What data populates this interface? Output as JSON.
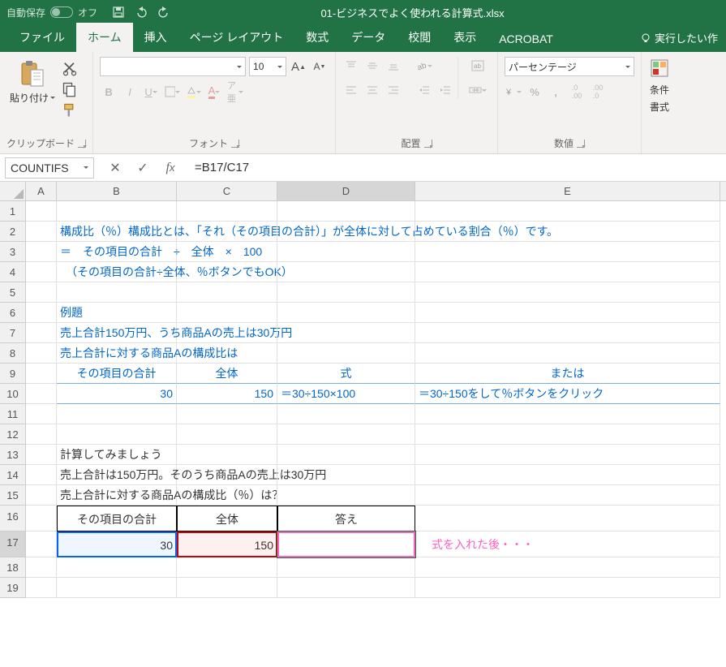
{
  "titlebar": {
    "autosave_label": "自動保存",
    "autosave_state": "オフ",
    "filename": "01-ビジネスでよく使われる計算式.xlsx"
  },
  "tabs": {
    "file": "ファイル",
    "home": "ホーム",
    "insert": "挿入",
    "page_layout": "ページ レイアウト",
    "formulas": "数式",
    "data": "データ",
    "review": "校閲",
    "view": "表示",
    "acrobat": "ACROBAT",
    "tell_me": "実行したい作"
  },
  "ribbon": {
    "clipboard": {
      "paste": "貼り付け",
      "label": "クリップボード"
    },
    "font": {
      "size": "10",
      "label": "フォント"
    },
    "alignment": {
      "label": "配置"
    },
    "number": {
      "format": "パーセンテージ",
      "label": "数値"
    },
    "styles": {
      "cond": "条件",
      "format": "書式"
    }
  },
  "formula_bar": {
    "name": "COUNTIFS",
    "formula": "=B17/C17"
  },
  "columns": [
    "A",
    "B",
    "C",
    "D",
    "E"
  ],
  "sheet": {
    "r2B": "構成比（％）構成比とは、「それ（その項目の合計）」が全体に対して占めている割合（％）です。",
    "r3B": "＝　その項目の合計　÷　全体　×　100",
    "r4B": "　（その項目の合計÷全体、％ボタンでもOK）",
    "r6B": "例題",
    "r7B": "売上合計150万円、うち商品Aの売上は30万円",
    "r8B": "売上合計に対する商品Aの構成比は",
    "r9B": "その項目の合計",
    "r9C": "全体",
    "r9D": "式",
    "r9E": "または",
    "r10B": "30",
    "r10C": "150",
    "r10D": "＝30÷150×100",
    "r10E": "＝30÷150をして％ボタンをクリック",
    "r13B": "計算してみましょう",
    "r14B": "売上合計は150万円。そのうち商品Aの売上は30万円",
    "r15B": "売上合計に対する商品Aの構成比（％）は？",
    "r16B": "その項目の合計",
    "r16C": "全体",
    "r16D": "答え",
    "r17B": "30",
    "r17C": "150",
    "r17D_b": "=B17",
    "r17D_s": "/",
    "r17D_c": "C17",
    "r17E": "式を入れた後・・・"
  }
}
